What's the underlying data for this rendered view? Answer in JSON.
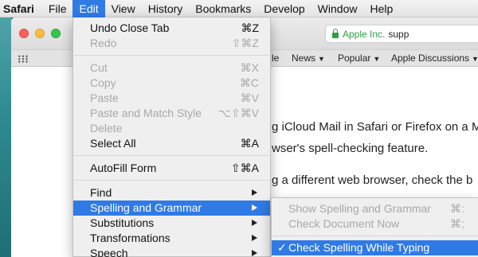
{
  "menubar": {
    "app": "Safari",
    "items": [
      "File",
      "Edit",
      "View",
      "History",
      "Bookmarks",
      "Develop",
      "Window",
      "Help"
    ]
  },
  "window": {
    "address": {
      "company": "Apple Inc.",
      "rest": "supp"
    },
    "favorites": [
      "le",
      "News",
      "Popular",
      "Apple Discussions"
    ],
    "content_lines": [
      "g iCloud Mail in Safari or Firefox on a M",
      "wser's spell-checking feature.",
      "g a different web browser, check the b"
    ]
  },
  "edit_menu": {
    "undo": {
      "label": "Undo Close Tab",
      "shortcut": "⌘Z"
    },
    "redo": {
      "label": "Redo",
      "shortcut": "⇧⌘Z"
    },
    "cut": {
      "label": "Cut",
      "shortcut": "⌘X"
    },
    "copy": {
      "label": "Copy",
      "shortcut": "⌘C"
    },
    "paste": {
      "label": "Paste",
      "shortcut": "⌘V"
    },
    "paste_match": {
      "label": "Paste and Match Style",
      "shortcut": "⌥⇧⌘V"
    },
    "delete": {
      "label": "Delete"
    },
    "select_all": {
      "label": "Select All",
      "shortcut": "⌘A"
    },
    "autofill": {
      "label": "AutoFill Form",
      "shortcut": "⇧⌘A"
    },
    "find": {
      "label": "Find"
    },
    "spelling": {
      "label": "Spelling and Grammar"
    },
    "substitutions": {
      "label": "Substitutions"
    },
    "transformations": {
      "label": "Transformations"
    },
    "speech": {
      "label": "Speech"
    }
  },
  "spelling_submenu": {
    "show": {
      "label": "Show Spelling and Grammar",
      "shortcut": "⌘:"
    },
    "check_doc": {
      "label": "Check Document Now",
      "shortcut": "⌘;"
    },
    "check_typing": {
      "label": "Check Spelling While Typing",
      "checkmark": "✓"
    }
  }
}
